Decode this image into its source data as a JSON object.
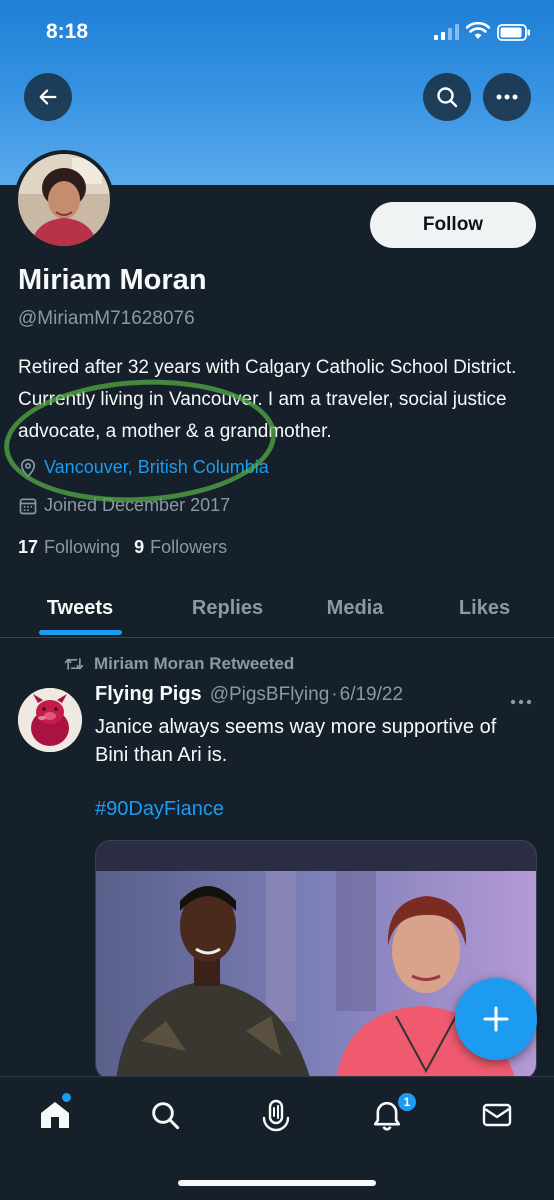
{
  "status_bar": {
    "time": "8:18"
  },
  "profile": {
    "name": "Miriam Moran",
    "handle": "@MiriamM71628076",
    "follow_label": "Follow",
    "bio": "Retired after 32 years with Calgary Catholic School District. Currently living in Vancouver. I am a traveler, social justice advocate, a mother & a grandmother.",
    "location": "Vancouver, British Columbia",
    "joined": "Joined December 2017",
    "following_count": "17",
    "following_label": "Following",
    "followers_count": "9",
    "followers_label": "Followers"
  },
  "tabs": [
    {
      "label": "Tweets",
      "active": true
    },
    {
      "label": "Replies",
      "active": false
    },
    {
      "label": "Media",
      "active": false
    },
    {
      "label": "Likes",
      "active": false
    }
  ],
  "tweet": {
    "retweet_context": "Miriam Moran Retweeted",
    "author_name": "Flying Pigs",
    "author_handle": "@PigsBFlying",
    "separator": "·",
    "date": "6/19/22",
    "text": "Janice always seems way more supportive of Bini than Ari is.",
    "hashtag": "#90DayFiance"
  },
  "nav": {
    "notification_badge": "1",
    "items": [
      "home-icon",
      "search-icon",
      "spaces-icon",
      "notifications-icon",
      "messages-icon"
    ]
  },
  "colors": {
    "background": "#15202b",
    "accent": "#1d9bf0",
    "text_primary": "#f7f9f9",
    "text_secondary": "#8b98a5",
    "annotation_circle": "#54aa46"
  }
}
